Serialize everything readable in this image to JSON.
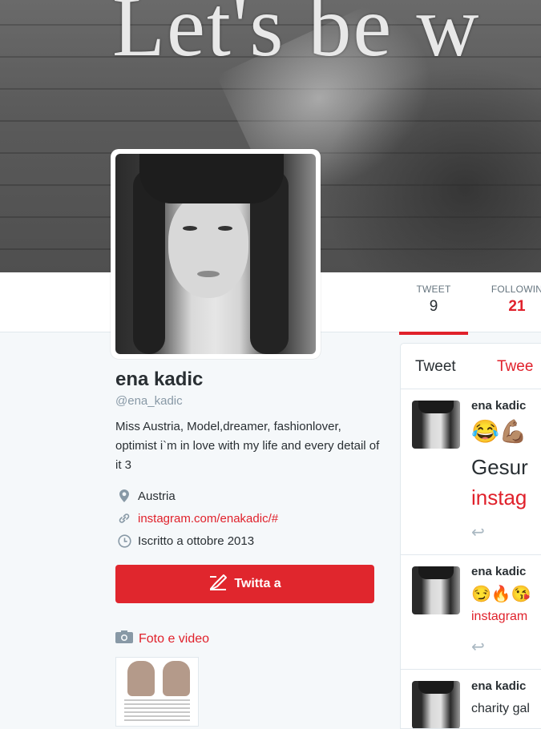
{
  "header": {
    "banner_text": "Let's be w"
  },
  "stats": [
    {
      "label": "TWEET",
      "value": "9"
    },
    {
      "label": "FOLLOWIN",
      "value": "21"
    }
  ],
  "profile": {
    "name": "ena kadic",
    "handle": "@ena_kadic",
    "bio": "Miss Austria, Model,dreamer, fashionlover, optimist i`m in love with my life and every detail of it 3",
    "location": "Austria",
    "website": "instagram.com/enakadic/#",
    "joined": "Iscritto a ottobre 2013"
  },
  "actions": {
    "tweet_to": "Twitta a"
  },
  "media": {
    "label": "Foto e video"
  },
  "timeline": {
    "tabs": [
      "Tweet",
      "Twee"
    ],
    "tweets": [
      {
        "name": "ena kadic",
        "emoji": "😂💪🏽",
        "text": "Gesur",
        "link": "instag"
      },
      {
        "name": "ena kadic",
        "emoji": "😏🔥😘",
        "link": "instagram"
      },
      {
        "name": "ena kadic",
        "text": "charity gal"
      }
    ]
  },
  "colors": {
    "accent": "#e0212b",
    "background": "#f5f8fa"
  }
}
